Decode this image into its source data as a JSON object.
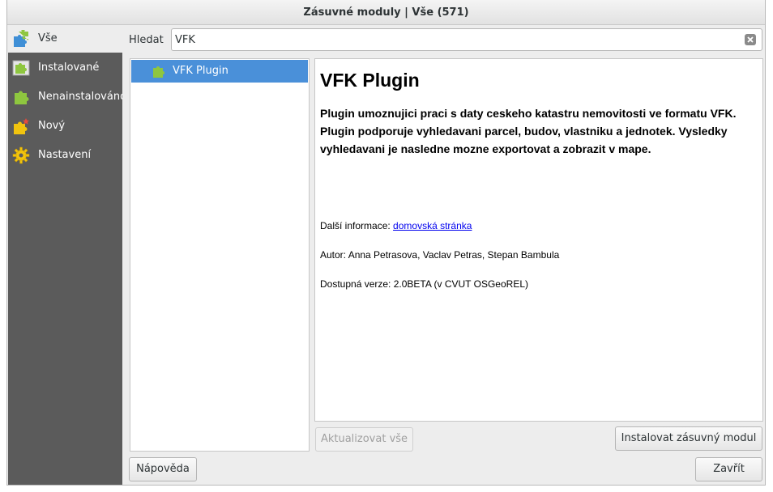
{
  "window": {
    "title": "Zásuvné moduly | Vše (571)"
  },
  "sidebar": {
    "items": [
      {
        "label": "Vše",
        "icon": "all-plugins-icon",
        "active": true
      },
      {
        "label": "Instalované",
        "icon": "installed-icon"
      },
      {
        "label": "Nenainstalováno",
        "icon": "not-installed-icon"
      },
      {
        "label": "Nový",
        "icon": "new-icon"
      },
      {
        "label": "Nastavení",
        "icon": "settings-gear-icon"
      }
    ]
  },
  "search": {
    "label": "Hledat",
    "value": "VFK"
  },
  "list": {
    "items": [
      {
        "label": "VFK Plugin"
      }
    ]
  },
  "details": {
    "title": "VFK Plugin",
    "description": "Plugin umoznujici praci s daty ceskeho katastru nemovitosti ve formatu VFK. Plugin podporuje vyhledavani parcel, budov, vlastniku a jednotek. Vysledky vyhledavani je nasledne mozne exportovat a zobrazit v mape.",
    "more_info_label": "Další informace:",
    "homepage_link": "domovská stránka",
    "author": "Autor: Anna Petrasova, Vaclav Petras, Stepan Bambula",
    "version": "Dostupná verze: 2.0BETA (v CVUT OSGeoREL)"
  },
  "buttons": {
    "upgrade_all": "Aktualizovat vše",
    "install": "Instalovat zásuvný modul",
    "help": "Nápověda",
    "close": "Zavřít"
  },
  "colors": {
    "sidebar_bg": "#5b5b5b",
    "selection": "#4a90d9",
    "plugin_green": "#8ec63f"
  }
}
